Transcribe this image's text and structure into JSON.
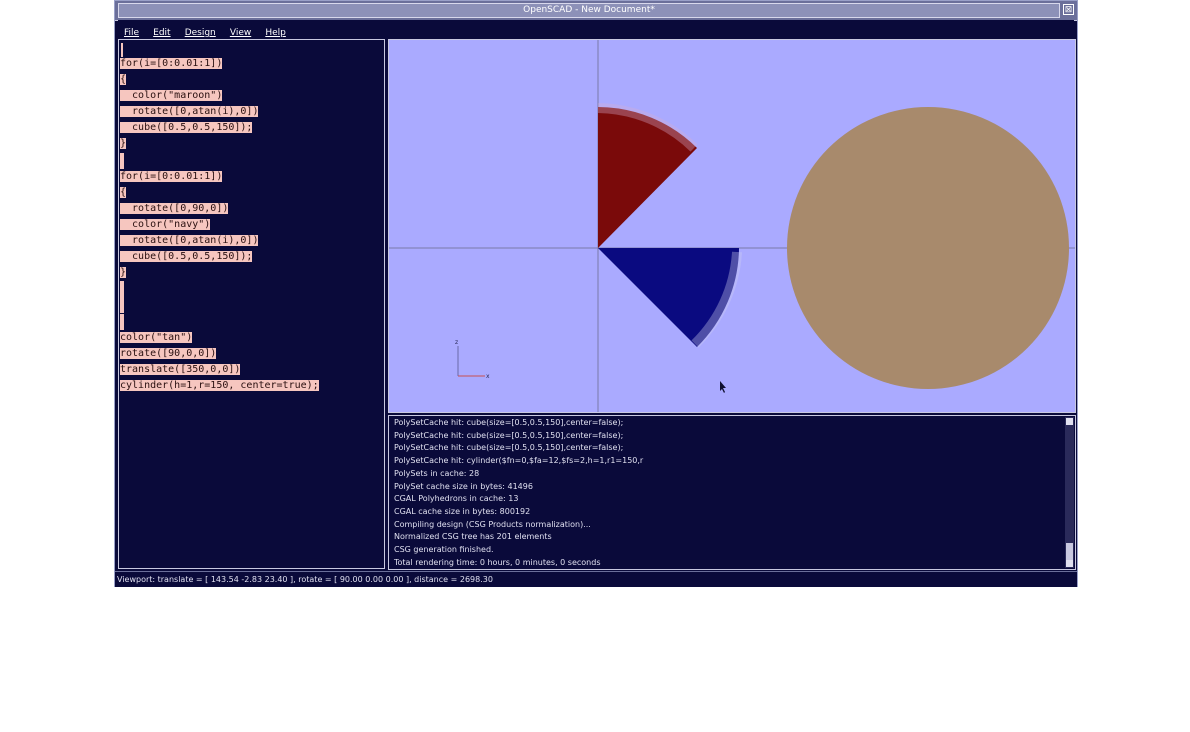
{
  "window": {
    "title": "OpenSCAD - New Document*",
    "close_glyph": "⊠"
  },
  "menu": [
    {
      "label": "File",
      "mnemonic_index": 0
    },
    {
      "label": "Edit",
      "mnemonic_index": 0
    },
    {
      "label": "Design",
      "mnemonic_index": 0
    },
    {
      "label": "View",
      "mnemonic_index": 0
    },
    {
      "label": "Help",
      "mnemonic_index": 0
    }
  ],
  "editor": {
    "lines": [
      "for(i=[0:0.01:1])",
      "{",
      "  color(\"maroon\")",
      "  rotate([0,atan(i),0])",
      "  cube([0.5,0.5,150]);",
      "}",
      "",
      "for(i=[0:0.01:1])",
      "{",
      "  rotate([0,90,0])",
      "  color(\"navy\")",
      "  rotate([0,atan(i),0])",
      "  cube([0.5,0.5,150]);",
      "}",
      "",
      "",
      "",
      "color(\"tan\")",
      "rotate([90,0,0])",
      "translate([350,0,0])",
      "cylinder(h=1,r=150, center=true);"
    ]
  },
  "viewport": {
    "background": "#aaaaff",
    "colors": {
      "maroon": "#7a0a0a",
      "navy": "#0a0a80",
      "tan": "#a88a6c",
      "axis": "#7a7aa8"
    },
    "axes_labels": {
      "z": "z",
      "x": "x"
    }
  },
  "console": {
    "lines": [
      "PolySetCache hit: cube(size=[0.5,0.5,150],center=false);",
      "PolySetCache hit: cube(size=[0.5,0.5,150],center=false);",
      "PolySetCache hit: cube(size=[0.5,0.5,150],center=false);",
      "PolySetCache hit: cylinder($fn=0,$fa=12,$fs=2,h=1,r1=150,r",
      "PolySets in cache: 28",
      "PolySet cache size in bytes: 41496",
      "CGAL Polyhedrons in cache: 13",
      "CGAL cache size in bytes: 800192",
      "Compiling design (CSG Products normalization)...",
      "Normalized CSG tree has 201 elements",
      "CSG generation finished.",
      "Total rendering time: 0 hours, 0 minutes, 0 seconds"
    ]
  },
  "status": {
    "text": "Viewport: translate = [ 143.54 -2.83 23.40 ], rotate = [ 90.00 0.00 0.00 ], distance = 2698.30"
  }
}
